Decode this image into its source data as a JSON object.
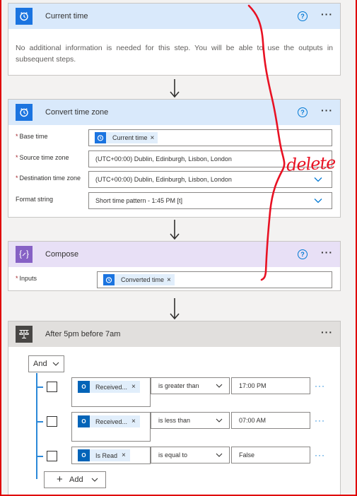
{
  "colors": {
    "accent_blue": "#1b74e0",
    "compose_purple": "#8661c5",
    "condition_dark": "#484644",
    "annotation_red": "#e81123"
  },
  "current_time": {
    "title": "Current time",
    "icon": "alarm-clock-icon",
    "info": "No additional information is needed for this step. You will be able to use the outputs in subsequent steps."
  },
  "convert_time_zone": {
    "title": "Convert time zone",
    "icon": "alarm-clock-icon",
    "base_time_label": "Base time",
    "base_time_token": "Current time",
    "source_tz_label": "Source time zone",
    "source_tz_value": "(UTC+00:00) Dublin, Edinburgh, Lisbon, London",
    "dest_tz_label": "Destination time zone",
    "dest_tz_value": "(UTC+00:00) Dublin, Edinburgh, Lisbon, London",
    "format_label": "Format string",
    "format_value": "Short time pattern - 1:45 PM [t]"
  },
  "compose": {
    "title": "Compose",
    "icon": "braces-icon",
    "inputs_label": "Inputs",
    "inputs_token": "Converted time"
  },
  "condition": {
    "title": "After 5pm before 7am",
    "icon": "condition-icon",
    "logic": "And",
    "rows": [
      {
        "token": "Received...",
        "operator": "is greater than",
        "value": "17:00 PM"
      },
      {
        "token": "Received...",
        "operator": "is less than",
        "value": "07:00 AM"
      },
      {
        "token": "Is Read",
        "operator": "is equal to",
        "value": "False"
      }
    ],
    "add_label": "Add"
  },
  "annotation": {
    "text": "delete"
  }
}
